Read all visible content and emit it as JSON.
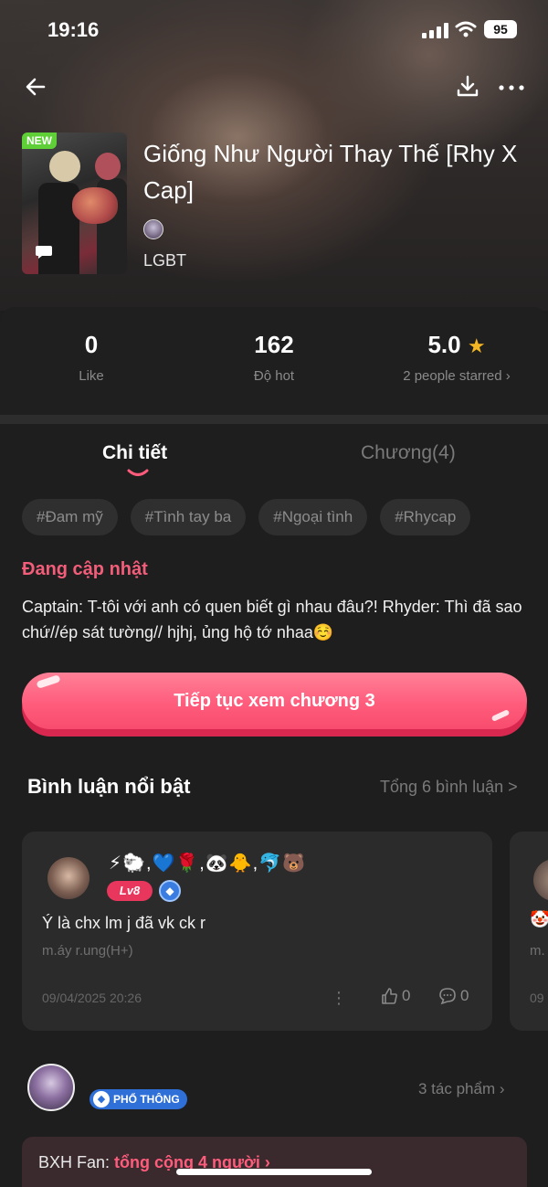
{
  "status_bar": {
    "time": "19:16",
    "battery": "95"
  },
  "book": {
    "new_badge": "NEW",
    "title": "Giống Như Người Thay Thế [Rhy X Cap]",
    "genre": "LGBT"
  },
  "stats": {
    "likes": {
      "value": "0",
      "label": "Like"
    },
    "hot": {
      "value": "162",
      "label": "Độ hot"
    },
    "rating": {
      "value": "5.0",
      "label": "2 people starred ›"
    }
  },
  "tabs": {
    "detail": "Chi tiết",
    "chapters": "Chương(4)"
  },
  "tags": [
    "#Đam mỹ",
    "#Tình tay ba",
    "#Ngoại tình",
    "#Rhycap"
  ],
  "status_text": "Đang cập nhật",
  "synopsis": "Captain: T-tôi với anh có quen biết gì nhau đâu?! Rhyder: Thì đã sao chứ//ép sát tường// hjhj, ủng hộ tớ nhaa☺️",
  "cta_label": "Tiếp tục xem chương 3",
  "comments_section": {
    "title": "Bình luận nổi bật",
    "total_link": "Tổng 6 bình luận >",
    "comments": [
      {
        "user_name": "⚡🐑,💙🌹,🐼🐥,🐬🐻",
        "level": "Lv8",
        "text": "Ý là chx lm j đã vk ck r",
        "sub": "m.áy r.ung(H+)",
        "date": "09/04/2025 20:26",
        "likes": "0",
        "replies": "0"
      },
      {
        "emoji": "🤡",
        "sub": "m.",
        "date": "09"
      }
    ]
  },
  "author": {
    "tier": "PHỔ THÔNG",
    "works_link": "3 tác phẩm ›"
  },
  "fan_rank": {
    "label": "BXH Fan: ",
    "count": "tổng cộng 4 người ›"
  }
}
